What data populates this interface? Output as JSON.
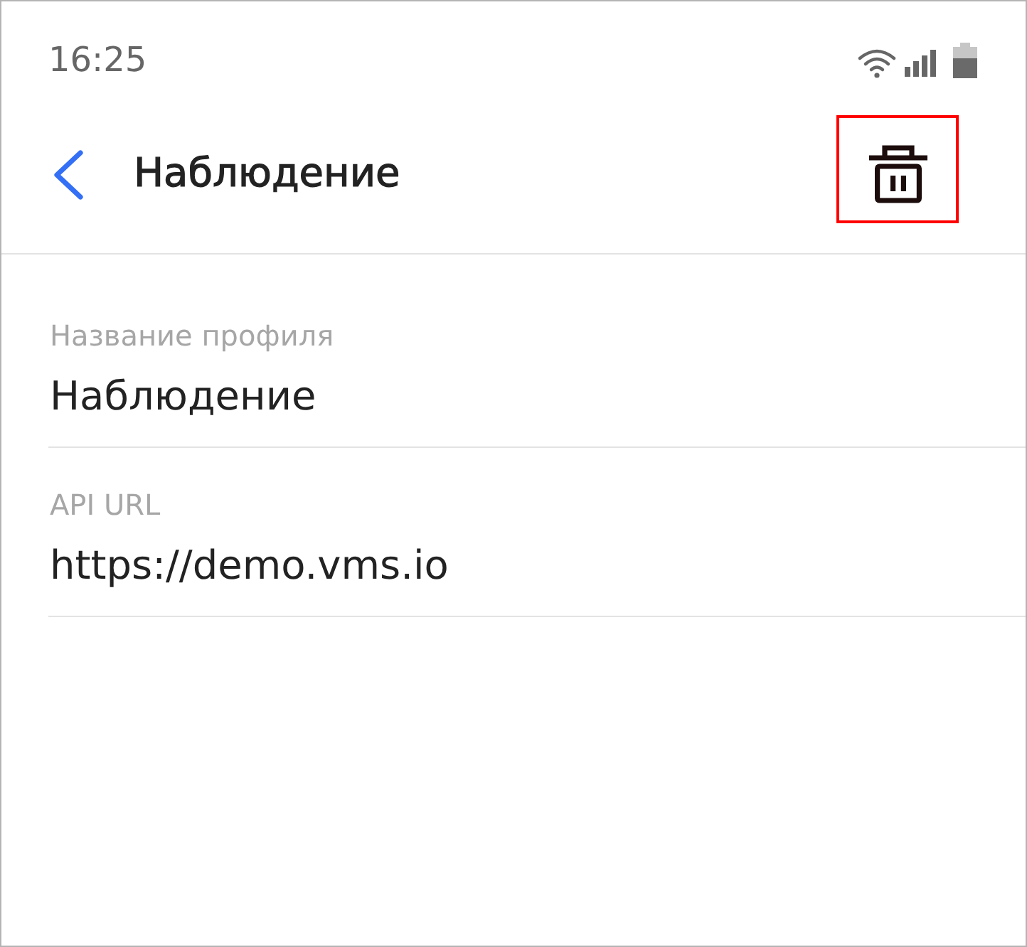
{
  "status_bar": {
    "time": "16:25"
  },
  "header": {
    "title": "Наблюдение",
    "delete_button": {
      "highlighted": true
    }
  },
  "fields": [
    {
      "label": "Название профиля",
      "value": "Наблюдение"
    },
    {
      "label": "API URL",
      "value": "https://demo.vms.io"
    }
  ]
}
